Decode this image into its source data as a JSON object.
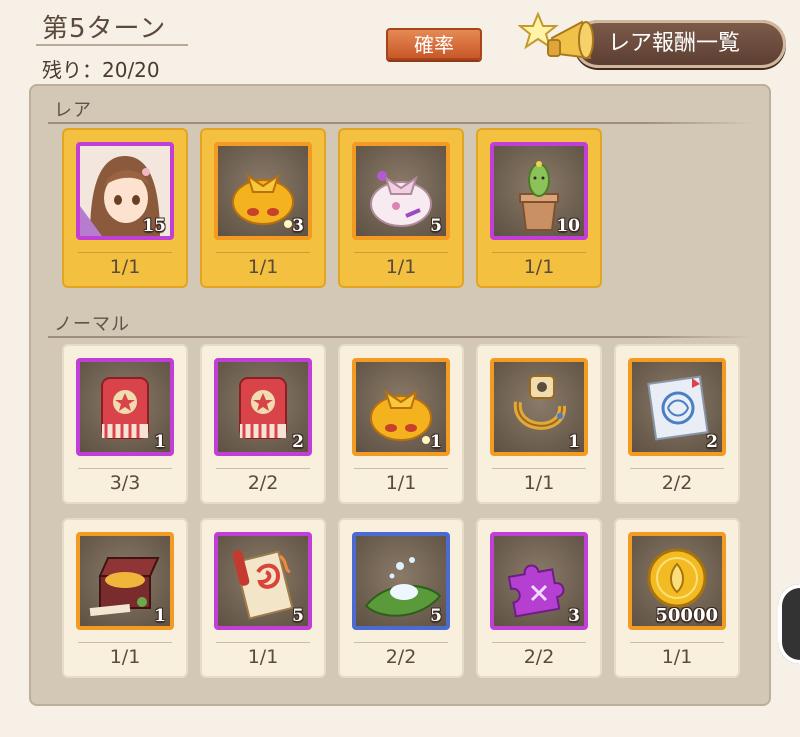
{
  "header": {
    "turn_title": "第5ターン",
    "remaining": "残り：20/20",
    "probability_label": "確率",
    "rare_list_label": "レア報酬一覧"
  },
  "sections": {
    "rare_label": "レア",
    "normal_label": "ノーマル"
  },
  "rare_items": [
    {
      "icon": "character-portrait-icon",
      "frame": "purple",
      "quantity": "15",
      "count": "1/1"
    },
    {
      "icon": "gold-pouch-icon",
      "frame": "orange",
      "quantity": "3",
      "count": "1/1"
    },
    {
      "icon": "pink-pouch-icon",
      "frame": "orange",
      "quantity": "5",
      "count": "1/1"
    },
    {
      "icon": "potted-cactus-icon",
      "frame": "purple",
      "quantity": "10",
      "count": "1/1"
    }
  ],
  "normal_items_row1": [
    {
      "icon": "red-ticket-bag-icon",
      "frame": "purple",
      "quantity": "1",
      "count": "3/3"
    },
    {
      "icon": "red-ticket-bag-icon",
      "frame": "purple",
      "quantity": "2",
      "count": "2/2"
    },
    {
      "icon": "gold-pouch-icon",
      "frame": "orange",
      "quantity": "1",
      "count": "1/1"
    },
    {
      "icon": "golden-ring-icon",
      "frame": "orange",
      "quantity": "1",
      "count": "1/1"
    },
    {
      "icon": "magic-scroll-icon",
      "frame": "orange",
      "quantity": "2",
      "count": "2/2"
    }
  ],
  "normal_items_row2": [
    {
      "icon": "treasure-chest-icon",
      "frame": "orange",
      "quantity": "1",
      "count": "1/1"
    },
    {
      "icon": "fire-scroll-icon",
      "frame": "purple",
      "quantity": "5",
      "count": "1/1"
    },
    {
      "icon": "sparkle-leaf-icon",
      "frame": "blue",
      "quantity": "5",
      "count": "2/2"
    },
    {
      "icon": "purple-puzzle-icon",
      "frame": "purple",
      "quantity": "3",
      "count": "2/2"
    },
    {
      "icon": "gold-coin-icon",
      "frame": "orange",
      "quantity": "50000",
      "count": "1/1"
    }
  ]
}
